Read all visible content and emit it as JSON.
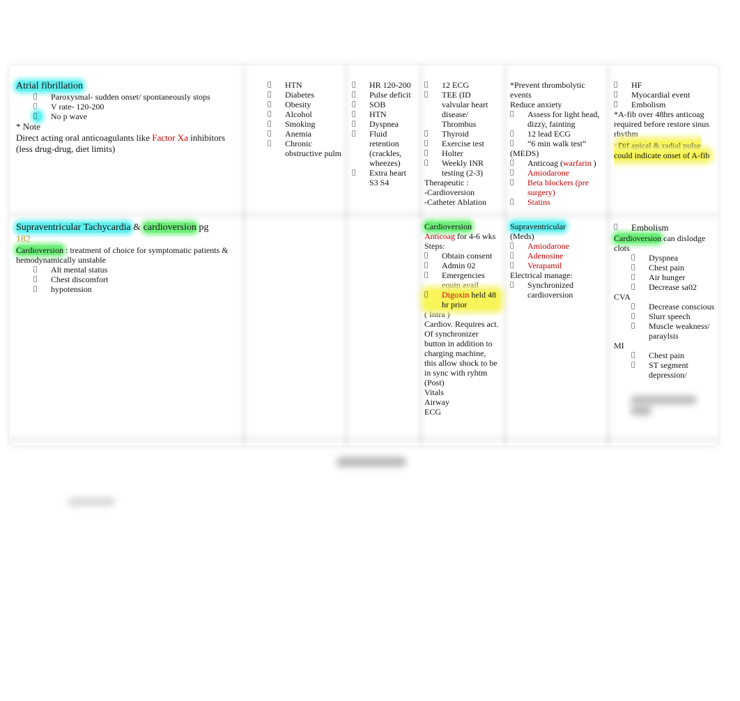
{
  "bullet_glyph": "",
  "row1": {
    "col1": {
      "title": "Atrial fibrillation",
      "bullets": [
        "Paroxysmal- sudden onset/ spontaneously stops",
        "V rate- 120-200",
        "No p wave"
      ],
      "note_label": "* Note",
      "doac_pre": "Direct acting oral anticoagulants like ",
      "doac_red": "Factor Xa",
      "doac_post": "  inhibitors (less drug-drug, diet limits)"
    },
    "col2": {
      "bullets": [
        "HTN",
        "Diabetes",
        "Obesity",
        "Alcohol",
        "Smoking",
        "Anemia",
        "Chronic obstructive pulm"
      ]
    },
    "col3": {
      "bullets": [
        "HR 120-200",
        "Pulse deficit",
        "SOB",
        "HTN",
        "Dyspnea",
        "Fluid retention (crackles, wheezes)",
        "Extra heart S3 S4"
      ]
    },
    "col4": {
      "bullets": [
        "12 ECG",
        "TEE  (ID valvular heart disease/ Thrombus",
        "Thyroid",
        "Exercise test",
        "Holter",
        "Weekly INR testing (2-3)"
      ],
      "therapeutic_label": "Therapeutic :",
      "therapeutic_items": [
        "-Cardioversion",
        "-Catheter Ablation"
      ]
    },
    "col5": {
      "prevent": "*Prevent thrombolytic events",
      "reduce": "Reduce anxiety",
      "bullets": [
        "Assess for light head, dizzy, fainting",
        "12 lead ECG",
        "“6 min walk test”"
      ],
      "meds_label": "(MEDS)",
      "anticoag_pre": "Anticoag (",
      "anticoag_red": "warfarin",
      "anticoag_post": "  )",
      "meds_red": [
        "Amiodarone",
        "Beta blockers (pre surgery)",
        "Statins"
      ]
    },
    "col6": {
      "bullets": [
        "HF",
        "Myocardial event",
        "Embolism"
      ],
      "note1": "*A-fib over 48hrs anticoag required before restore sinus rhythm",
      "note2_star": "*",
      "note2": "Dif apical & radial pulse could indicate onset of A-fib"
    }
  },
  "row2": {
    "col1": {
      "title_cyan": "Supraventricular Tachycardia",
      "title_amp": "  & ",
      "title_green": "cardioversion",
      "title_pg": " pg",
      "page_ref": "182",
      "cardio_label": "Cardioversion",
      "cardio_text": " : treatment of choice for symptomatic patients & hemodynamically unstable",
      "bullets": [
        "Alt mental status",
        "Chest discomfort",
        "hypotension"
      ]
    },
    "col4": {
      "title": "Cardioversion",
      "anticoag_red": "Anticoag",
      "anticoag_post": " for 4-6 wks",
      "steps_label": "Steps:",
      "steps": [
        "Obtain consent",
        "Admin 02",
        "Emergencies equip avail"
      ],
      "digoxin_red": "Digoxin",
      "digoxin_post": " held 48 hr prior",
      "intra_label": "( Intra )",
      "intra_text": "Cardiov. Requires act. Of synchronizer button in addition to charging machine, this allow shock to be in sync with ryhtm",
      "post_label": "(Post)",
      "post_items": [
        "Vitals",
        "Airway",
        "ECG"
      ]
    },
    "col5": {
      "title": "Supraventricular",
      "meds_label": "(Meds)",
      "meds_red": [
        "Amiodarone",
        "Adenosine",
        "Verapamil"
      ],
      "electrical_label": "Electrical  manage:",
      "electrical_items": [
        "Synchronized cardioversion"
      ]
    },
    "col6": {
      "embolism": "Embolism",
      "cardio_label": "Cardioversion",
      "cardio_post": " can dislodge clots",
      "embolism_items": [
        "Dyspnea",
        "Chest pain",
        "Air hunger",
        "Decrease sa02"
      ],
      "cva_label": "CVA",
      "cva_items": [
        "Decrease conscious",
        "Slurr speech",
        "Muscle weakness/ paraylsis"
      ],
      "mi_label": "MI",
      "mi_items": [
        "Chest pain",
        "ST segment depression/"
      ]
    }
  }
}
